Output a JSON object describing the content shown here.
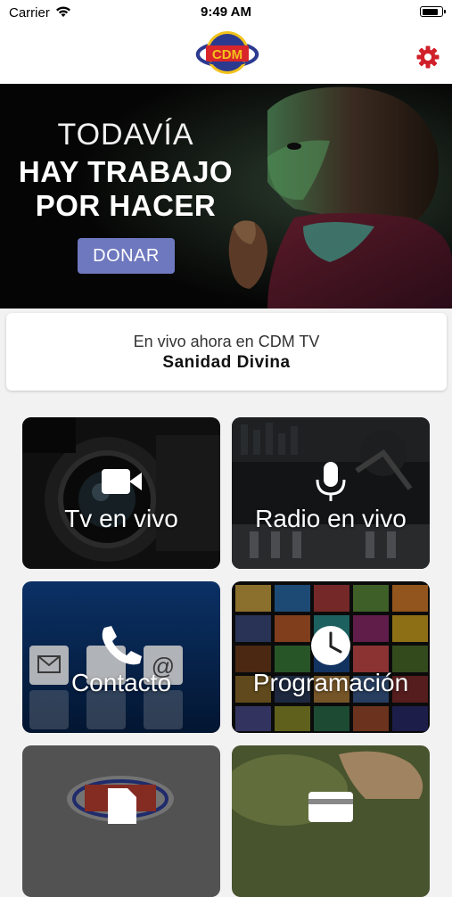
{
  "status_bar": {
    "carrier": "Carrier",
    "time": "9:49 AM",
    "battery_level": 0.85
  },
  "header": {
    "logo_text": "CDM"
  },
  "banner": {
    "line1": "TODAVÍA",
    "line2": "HAY TRABAJO",
    "line3": "POR HACER",
    "donate_label": "DONAR"
  },
  "live": {
    "subtitle": "En vivo ahora en CDM TV",
    "program": "Sanidad Divina"
  },
  "tiles": [
    {
      "label": "Tv en vivo",
      "icon": "video-camera-icon"
    },
    {
      "label": "Radio en vivo",
      "icon": "microphone-icon"
    },
    {
      "label": "Contacto",
      "icon": "phone-icon"
    },
    {
      "label": "Programación",
      "icon": "clock-icon"
    },
    {
      "label": "",
      "icon": "document-icon"
    },
    {
      "label": "",
      "icon": "card-icon"
    }
  ],
  "colors": {
    "accent": "#6e78be",
    "settings": "#d0202a",
    "logo_red": "#d8262a",
    "logo_yellow": "#f2c21b"
  }
}
